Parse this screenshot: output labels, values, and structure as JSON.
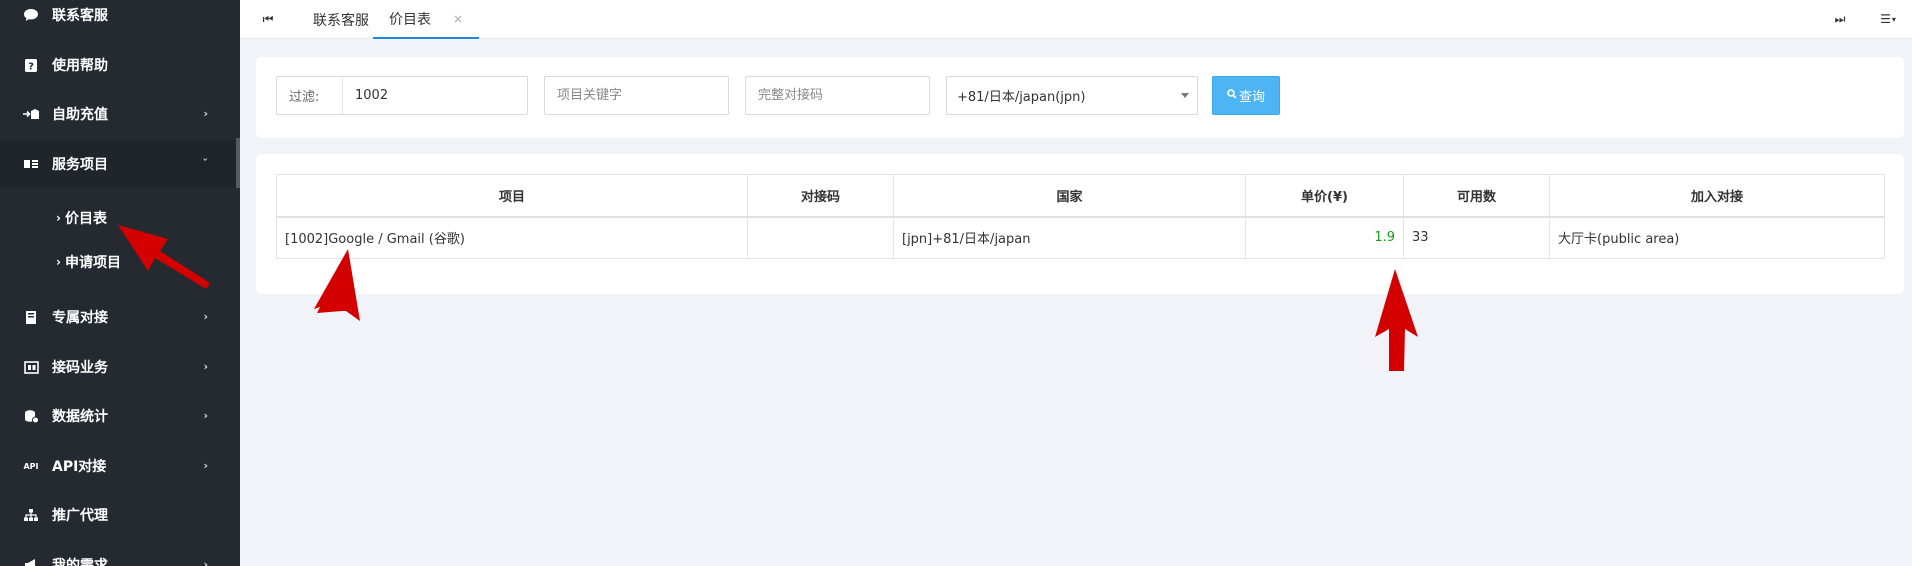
{
  "sidebar": {
    "items": [
      {
        "label": "联系客服",
        "icon": "chat-bubble-icon",
        "has_arrow": false
      },
      {
        "label": "使用帮助",
        "icon": "help-icon",
        "has_arrow": false
      },
      {
        "label": "自助充值",
        "icon": "recharge-icon",
        "has_arrow": true
      },
      {
        "label": "服务项目",
        "icon": "service-card-icon",
        "has_arrow": true,
        "open": true
      },
      {
        "label": "专属对接",
        "icon": "book-icon",
        "has_arrow": true
      },
      {
        "label": "接码业务",
        "icon": "code-icon",
        "has_arrow": true
      },
      {
        "label": "数据统计",
        "icon": "database-icon",
        "has_arrow": true
      },
      {
        "label": "API对接",
        "icon": "api-icon",
        "has_arrow": true
      },
      {
        "label": "推广代理",
        "icon": "sitemap-icon",
        "has_arrow": false
      },
      {
        "label": "我的需求",
        "icon": "megaphone-icon",
        "has_arrow": true
      }
    ],
    "sub_items": [
      {
        "label": "价目表",
        "active": true
      },
      {
        "label": "申请项目",
        "active": false
      }
    ],
    "icon_glyphs": {
      "api": "API"
    }
  },
  "tabs": [
    {
      "label": "联系客服",
      "active": false
    },
    {
      "label": "价目表",
      "active": true,
      "close": "×"
    }
  ],
  "filter": {
    "label": "过滤:",
    "value": "1002",
    "keyword_placeholder": "项目关键字",
    "code_placeholder": "完整对接码",
    "country_selected": "+81/日本/japan(jpn)",
    "query_button": "查询"
  },
  "table": {
    "headers": [
      "项目",
      "对接码",
      "国家",
      "单价(¥)",
      "可用数",
      "加入对接"
    ],
    "rows": [
      [
        "[1002]Google / Gmail (谷歌)",
        "",
        "[jpn]+81/日本/japan",
        "1.9",
        "33",
        "大厅卡(public area)"
      ]
    ]
  },
  "colors": {
    "sidebar_bg": "#242a30",
    "accent": "#1e88e5",
    "query_button": "#4eb5f5",
    "price_text": "#1a9a1a",
    "annotation_arrow": "#d40000"
  }
}
